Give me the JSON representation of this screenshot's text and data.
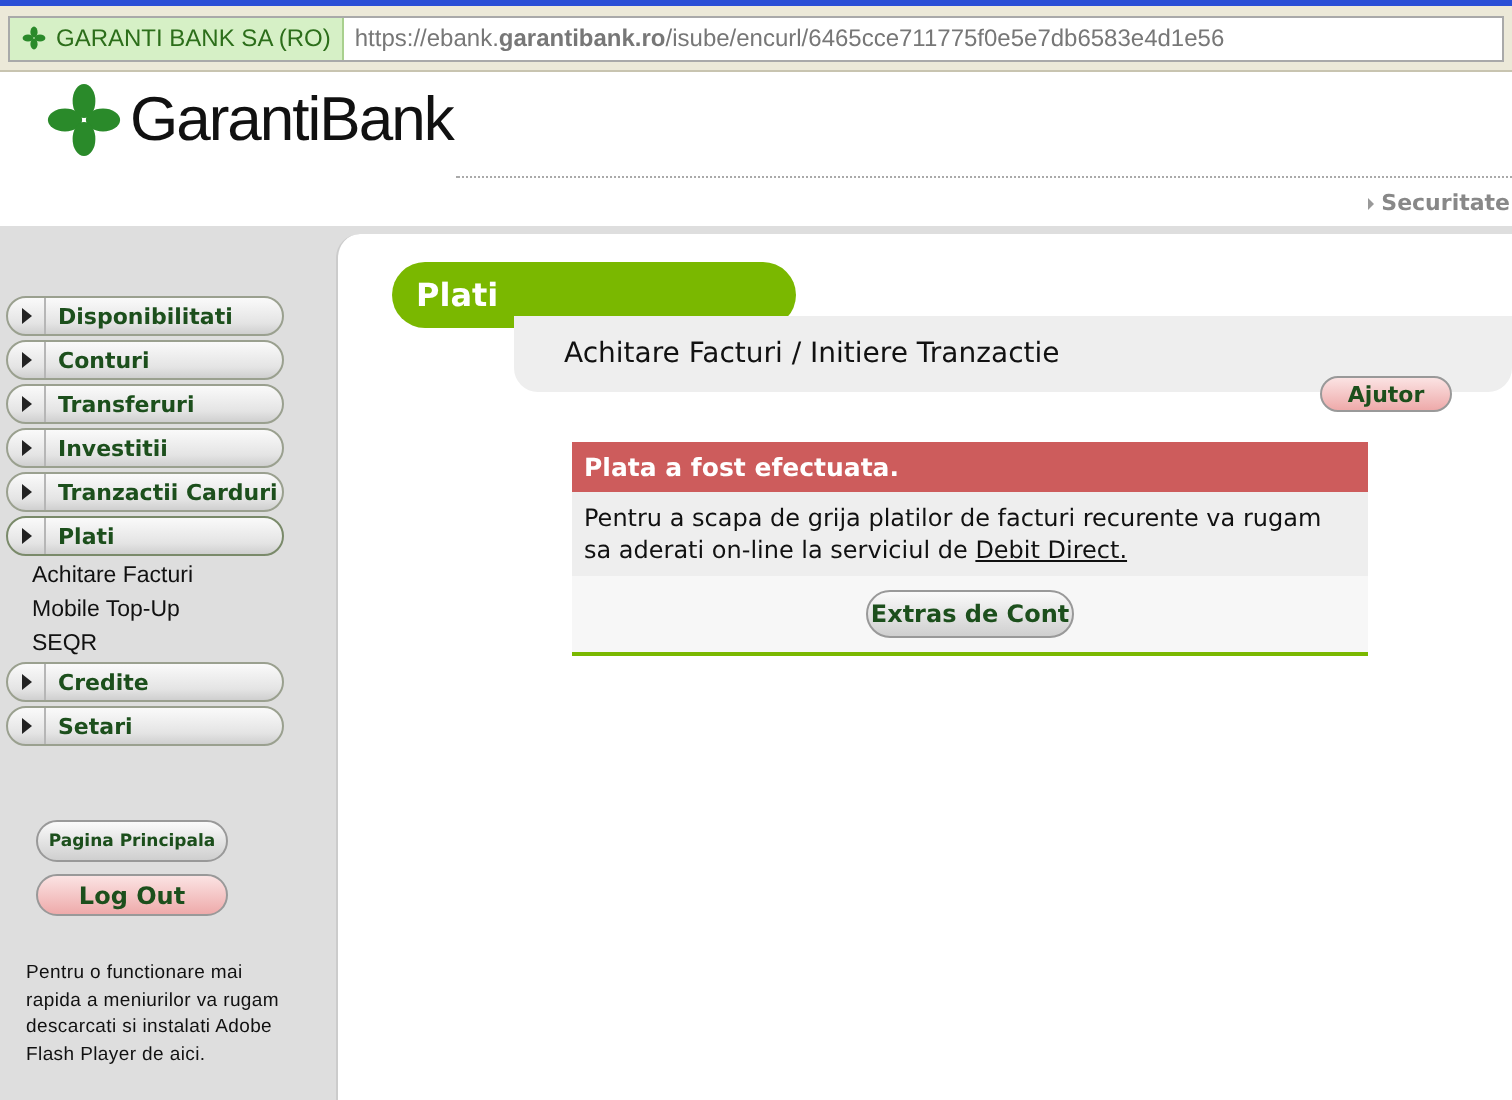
{
  "address_bar": {
    "identity": "GARANTI BANK SA (RO)",
    "url": "https://ebank.**garantibank.ro**/isube/encurl/6465cce711775f0e5e7db6583e4d1e56"
  },
  "header": {
    "logo": "GarantiBank",
    "top_link": "Securitate"
  },
  "sidebar": {
    "menu": [
      {
        "label": "Disponibilitati",
        "expanded": false
      },
      {
        "label": "Conturi",
        "expanded": false
      },
      {
        "label": "Transferuri",
        "expanded": false
      },
      {
        "label": "Investitii",
        "expanded": false
      },
      {
        "label": "Tranzactii Carduri",
        "expanded": false
      },
      {
        "label": "Plati",
        "expanded": true,
        "children": [
          "Achitare Facturi",
          "Mobile Top-Up",
          "SEQR"
        ]
      },
      {
        "label": "Credite",
        "expanded": false
      },
      {
        "label": "Setari",
        "expanded": false
      }
    ],
    "home_button": "Pagina Principala",
    "logout_button": "Log Out",
    "note": "Pentru o functionare mai rapida a meniurilor va rugam descarcati si instalati Adobe Flash Player de aici."
  },
  "main": {
    "section": "Plati",
    "title": "Achitare Facturi / Initiere Tranzactie",
    "help_button": "Ajutor",
    "message": {
      "heading": "Plata a fost efectuata.",
      "text": "Pentru a scapa de grija platilor de facturi recurente va rugam sa aderati on-line la serviciul de",
      "link": "Debit Direct.",
      "button": "Extras de Cont"
    }
  }
}
